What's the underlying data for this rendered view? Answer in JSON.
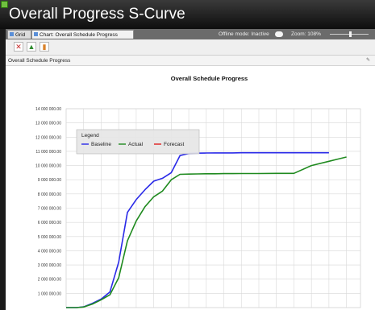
{
  "window": {
    "title": "Overall Progress S-Curve"
  },
  "tabs": [
    {
      "label": "Grid",
      "icon": "grid-icon"
    },
    {
      "label": "Chart: Overall Schedule Progress",
      "icon": "chart-icon"
    }
  ],
  "status": {
    "offline_label": "Offline mode: Inactive",
    "zoom_label": "Zoom: 108%"
  },
  "toolbar": {
    "buttons": [
      {
        "icon": "delete-icon"
      },
      {
        "icon": "export-icon"
      },
      {
        "icon": "chart-settings-icon"
      }
    ]
  },
  "panel": {
    "title": "Overall Schedule Progress"
  },
  "colors": {
    "baseline": "#2a2ae8",
    "actual": "#1f8a1f",
    "forecast": "#e02020",
    "grid": "#d8d8d8"
  },
  "chart_data": {
    "type": "line",
    "title": "Overall Schedule Progress",
    "xlabel": "",
    "ylabel": "",
    "ylim": [
      0,
      14000000
    ],
    "y_ticks": [
      "",
      "1 000 000.00",
      "2 000 000.00",
      "3 000 000.00",
      "4 000 000.00",
      "5 000 000.00",
      "6 000 000.00",
      "7 000 000.00",
      "8 000 000.00",
      "9 000 000.00",
      "10 000 000.00",
      "11 000 000.00",
      "12 000 000.00",
      "13 000 000.00",
      "14 000 000.00"
    ],
    "grid": true,
    "legend": {
      "title": "Legend",
      "position": "top-left",
      "entries": [
        "Baseline",
        "Actual",
        "Forecast"
      ]
    },
    "x": [
      0,
      0.6,
      1,
      1.5,
      2,
      2.5,
      3,
      3.5,
      4,
      4.5,
      5,
      5.5,
      6,
      6.5,
      7,
      7.5,
      8,
      8.5,
      9,
      9.5,
      10,
      11,
      12,
      13,
      14,
      15,
      15.5,
      16
    ],
    "series": [
      {
        "name": "Baseline",
        "values": [
          0,
          0,
          50000,
          300000,
          600000,
          1100000,
          3200000,
          6700000,
          7600000,
          8300000,
          8900000,
          9100000,
          9500000,
          10700000,
          10850000,
          10870000,
          10880000,
          10890000,
          10890000,
          10890000,
          10900000,
          10900000,
          10900000,
          10900000,
          10900000,
          10900000,
          null,
          null
        ]
      },
      {
        "name": "Actual",
        "values": [
          0,
          0,
          40000,
          250000,
          550000,
          900000,
          2100000,
          4700000,
          6100000,
          7100000,
          7800000,
          8200000,
          9000000,
          9380000,
          9400000,
          9410000,
          9420000,
          9420000,
          9430000,
          9430000,
          9440000,
          9440000,
          9450000,
          9450000,
          10000000,
          10300000,
          10450000,
          10600000
        ]
      },
      {
        "name": "Forecast",
        "values": []
      }
    ]
  }
}
